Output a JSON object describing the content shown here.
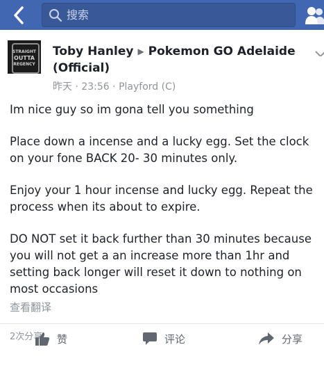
{
  "colors": {
    "topbar": "#4267b2",
    "searchbox": "#385898",
    "text": "#1d2129",
    "muted": "#90949c"
  },
  "search": {
    "placeholder": "搜索"
  },
  "post": {
    "author": "Toby Hanley",
    "group": "Pokemon GO Adelaide (Official)",
    "avatar_text": [
      "STRAIGHT",
      "OUTTA",
      "REGENCY"
    ],
    "meta": {
      "date": "昨天",
      "time": "23:56",
      "location": "Playford (C)"
    },
    "paragraphs": [
      "Im nice guy so im gona tell you something",
      "Place down a incense and a lucky egg. Set the clock on your fone BACK 20- 30 minutes only.",
      "Enjoy your 1 hour incense and lucky egg. Repeat the process when its about to expire.",
      "DO NOT set it back further than 30 minutes because you will not get a an increase more than 1hr and setting back longer will reset it down to nothing on most occasions"
    ],
    "see_translation": "查看翻译",
    "share_count": "2次分享"
  },
  "actions": {
    "like": "赞",
    "comment": "评论",
    "share": "分享"
  }
}
